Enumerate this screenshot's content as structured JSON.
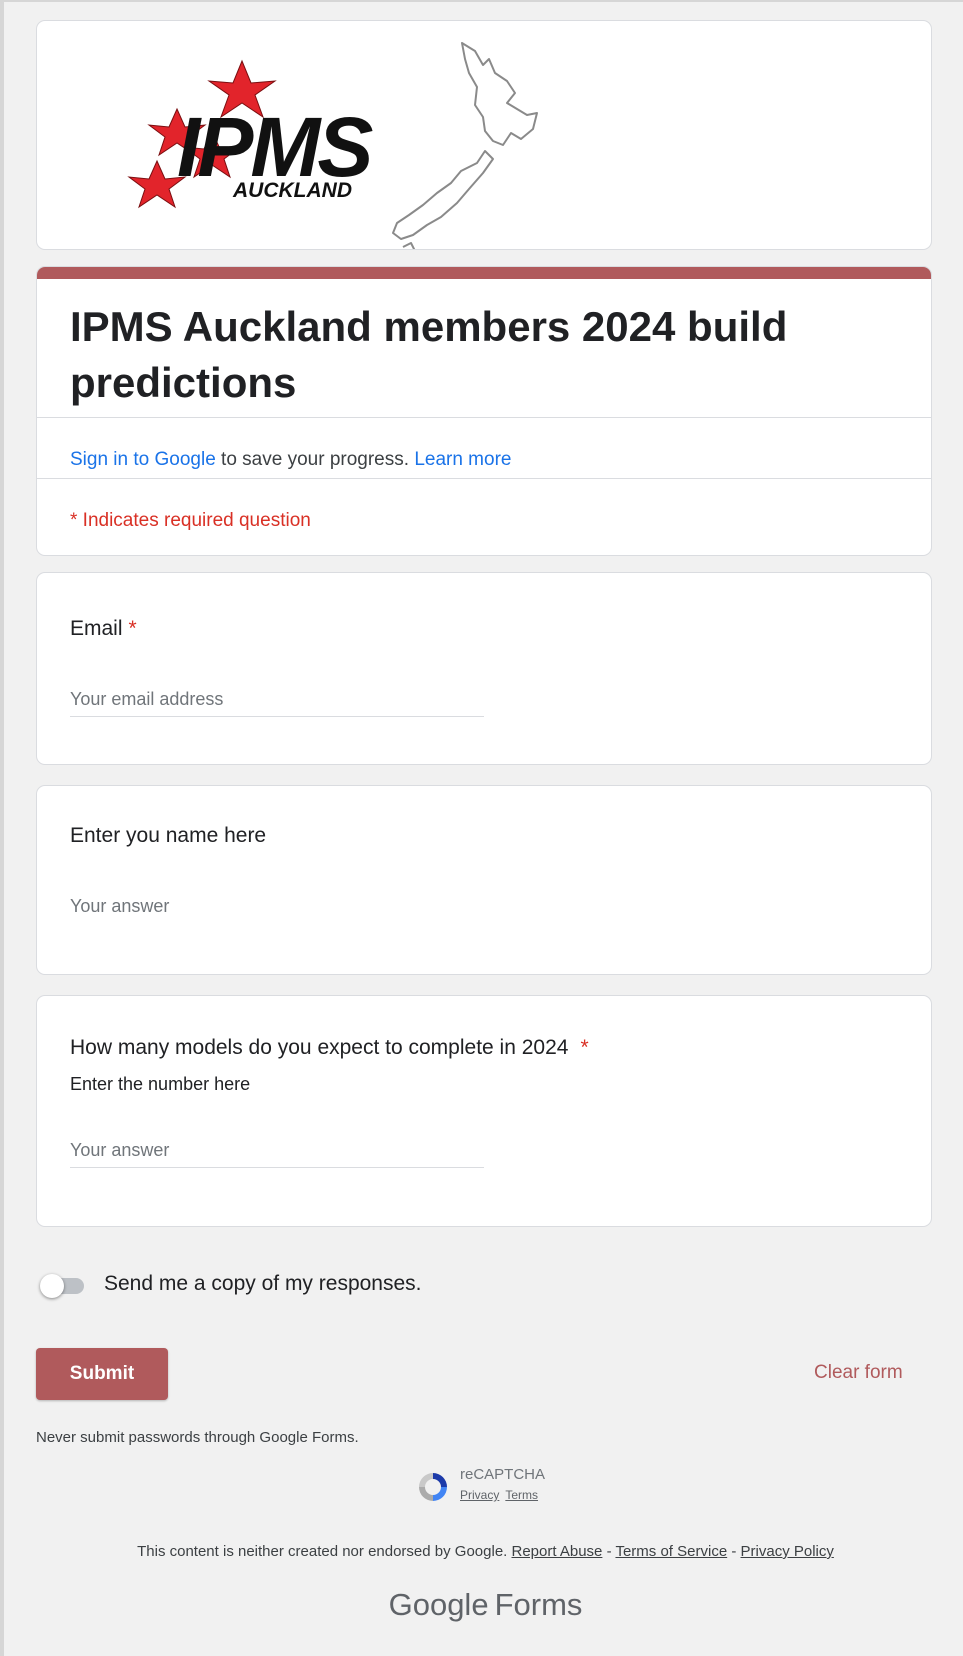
{
  "header": {
    "logo_text": "IPMS",
    "logo_subtext": "AUCKLAND",
    "logo_icon": "new-zealand-map-icon"
  },
  "form": {
    "title": "IPMS Auckland members 2024 build predictions",
    "accent_color": "#b05a5c",
    "signin_link": "Sign in to Google",
    "signin_rest": " to save your progress. ",
    "learn_more": "Learn more",
    "required_note": "* Indicates required question"
  },
  "questions": [
    {
      "label": "Email",
      "required_mark": "*",
      "placeholder": "Your email address"
    },
    {
      "label": "Enter you name here",
      "placeholder": "Your answer"
    },
    {
      "label": "How many models do you expect to complete in 2024",
      "required_mark": "*",
      "sublabel": "Enter the number here",
      "placeholder": "Your answer"
    }
  ],
  "copy_toggle": {
    "label": "Send me a copy of my responses.",
    "checked": false
  },
  "actions": {
    "submit": "Submit",
    "clear": "Clear form"
  },
  "never_submit": "Never submit passwords through Google Forms.",
  "recaptcha": {
    "label": "reCAPTCHA",
    "privacy": "Privacy",
    "terms": "Terms",
    "icon": "recaptcha-icon"
  },
  "footer": {
    "disclaimer": "This content is neither created nor endorsed by Google.",
    "report_abuse": "Report Abuse",
    "terms_of_service": "Terms of Service",
    "privacy_policy": "Privacy Policy",
    "separator": " - "
  },
  "branding": {
    "google": "Google",
    "forms": "Forms"
  }
}
